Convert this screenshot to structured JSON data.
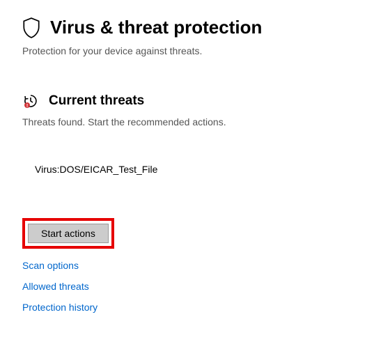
{
  "header": {
    "title": "Virus & threat protection",
    "subtitle": "Protection for your device against threats."
  },
  "current_threats": {
    "title": "Current threats",
    "subtitle": "Threats found. Start the recommended actions.",
    "items": [
      {
        "name": "Virus:DOS/EICAR_Test_File"
      }
    ]
  },
  "actions": {
    "start_label": "Start actions"
  },
  "links": {
    "scan_options": "Scan options",
    "allowed_threats": "Allowed threats",
    "protection_history": "Protection history"
  }
}
